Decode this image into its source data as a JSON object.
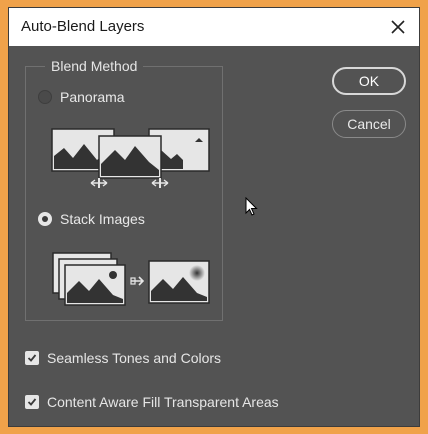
{
  "dialog": {
    "title": "Auto-Blend Layers",
    "close_icon": "close-icon"
  },
  "blend_method": {
    "legend": "Blend Method",
    "options": [
      {
        "label": "Panorama",
        "selected": false,
        "illustration": "panorama-illustration"
      },
      {
        "label": "Stack Images",
        "selected": true,
        "illustration": "stack-images-illustration"
      }
    ]
  },
  "buttons": {
    "ok_label": "OK",
    "cancel_label": "Cancel"
  },
  "options": {
    "seamless_label": "Seamless Tones and Colors",
    "seamless_checked": true,
    "content_aware_label": "Content Aware Fill Transparent Areas",
    "content_aware_checked": true
  },
  "colors": {
    "dialog_bg": "#535353",
    "titlebar_bg": "#ffffff",
    "outer_bg": "#f0a24a"
  }
}
